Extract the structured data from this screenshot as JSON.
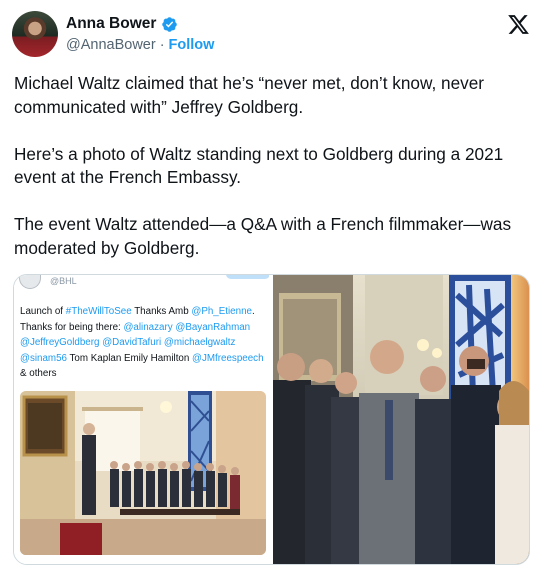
{
  "author": {
    "name": "Anna Bower",
    "handle": "@AnnaBower",
    "separator": "·",
    "follow_label": "Follow",
    "verified": true
  },
  "tweet": {
    "paragraphs": [
      "Michael Waltz claimed that he’s “never met, don’t know, never communicated with” Jeffrey Goldberg.",
      "Here’s a photo of Waltz standing next to Goldberg during a 2021 event at the French Embassy.",
      "The event Waltz attended—a Q&A with a French filmmaker—was moderated by Goldberg."
    ]
  },
  "embedded": {
    "handle": "@BHL",
    "text_parts": [
      {
        "text": "Launch of ",
        "link": false
      },
      {
        "text": "#TheWillToSee",
        "link": true
      },
      {
        "text": " Thanks Amb ",
        "link": false
      },
      {
        "text": "@Ph_Etienne",
        "link": true
      },
      {
        "text": ". Thanks for being there: ",
        "link": false
      },
      {
        "text": "@alinazary",
        "link": true
      },
      {
        "text": " ",
        "link": false
      },
      {
        "text": "@BayanRahman",
        "link": true
      },
      {
        "text": " ",
        "link": false
      },
      {
        "text": "@JeffreyGoldberg",
        "link": true
      },
      {
        "text": " ",
        "link": false
      },
      {
        "text": "@DavidTafuri",
        "link": true
      },
      {
        "text": " ",
        "link": false
      },
      {
        "text": "@michaelgwaltz",
        "link": true
      },
      {
        "text": " ",
        "link": false
      },
      {
        "text": "@sinam56",
        "link": true
      },
      {
        "text": " Tom Kaplan Emily Hamilton ",
        "link": false
      },
      {
        "text": "@JMfreespeech",
        "link": true
      },
      {
        "text": " & others",
        "link": false
      }
    ]
  },
  "icons": {
    "verified": "verified-badge-icon",
    "platform": "x-logo-icon"
  },
  "colors": {
    "accent": "#1d9bf0",
    "text": "#0f1419",
    "secondary": "#536471"
  }
}
